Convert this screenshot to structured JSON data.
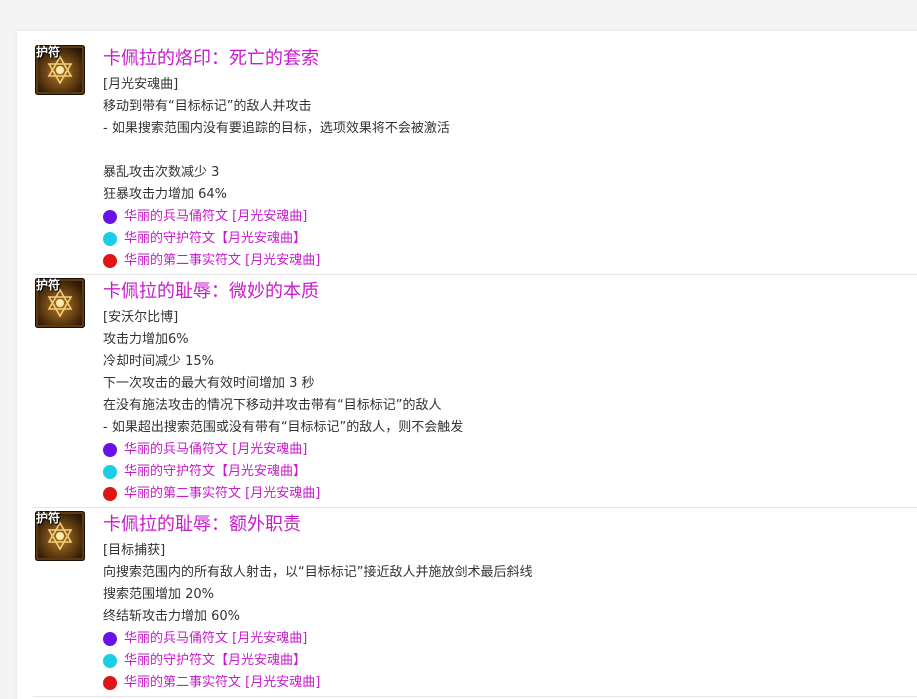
{
  "colors": {
    "title": "#c71bcc",
    "text": "#333333",
    "dot_purple": "#6a10e8",
    "dot_cyan": "#18cfe6",
    "dot_red": "#e01515"
  },
  "icon_tag": "护符",
  "entries": [
    {
      "title": "卡佩拉的烙印：死亡的套索",
      "lines": [
        "[月光安魂曲]",
        "移动到带有“目标标记”的敌人并攻击",
        " - 如果搜索范围内没有要追踪的目标，选项效果将不会被激活",
        "",
        "暴乱攻击次数减少 3",
        "狂暴攻击力增加 64%"
      ],
      "runes": [
        "华丽的兵马俑符文 [月光安魂曲]",
        "华丽的守护符文【月光安魂曲】",
        "华丽的第二事实符文 [月光安魂曲]"
      ]
    },
    {
      "title": "卡佩拉的耻辱：微妙的本质",
      "lines": [
        "[安沃尔比博]",
        "攻击力增加6%",
        "冷却时间减少 15%",
        "下一次攻击的最大有效时间增加 3 秒",
        "在没有施法攻击的情况下移动并攻击带有“目标标记”的敌人",
        " - 如果超出搜索范围或没有带有“目标标记”的敌人，则不会触发"
      ],
      "runes": [
        "华丽的兵马俑符文 [月光安魂曲]",
        "华丽的守护符文【月光安魂曲】",
        "华丽的第二事实符文 [月光安魂曲]"
      ]
    },
    {
      "title": "卡佩拉的耻辱：额外职责",
      "lines": [
        "[目标捕获]",
        "向搜索范围内的所有敌人射击，以“目标标记”接近敌人并施放剑术最后斜线",
        "搜索范围增加 20%",
        "终结斩攻击力增加 60%"
      ],
      "runes": [
        "华丽的兵马俑符文 [月光安魂曲]",
        "华丽的守护符文【月光安魂曲】",
        "华丽的第二事实符文 [月光安魂曲]"
      ]
    }
  ]
}
